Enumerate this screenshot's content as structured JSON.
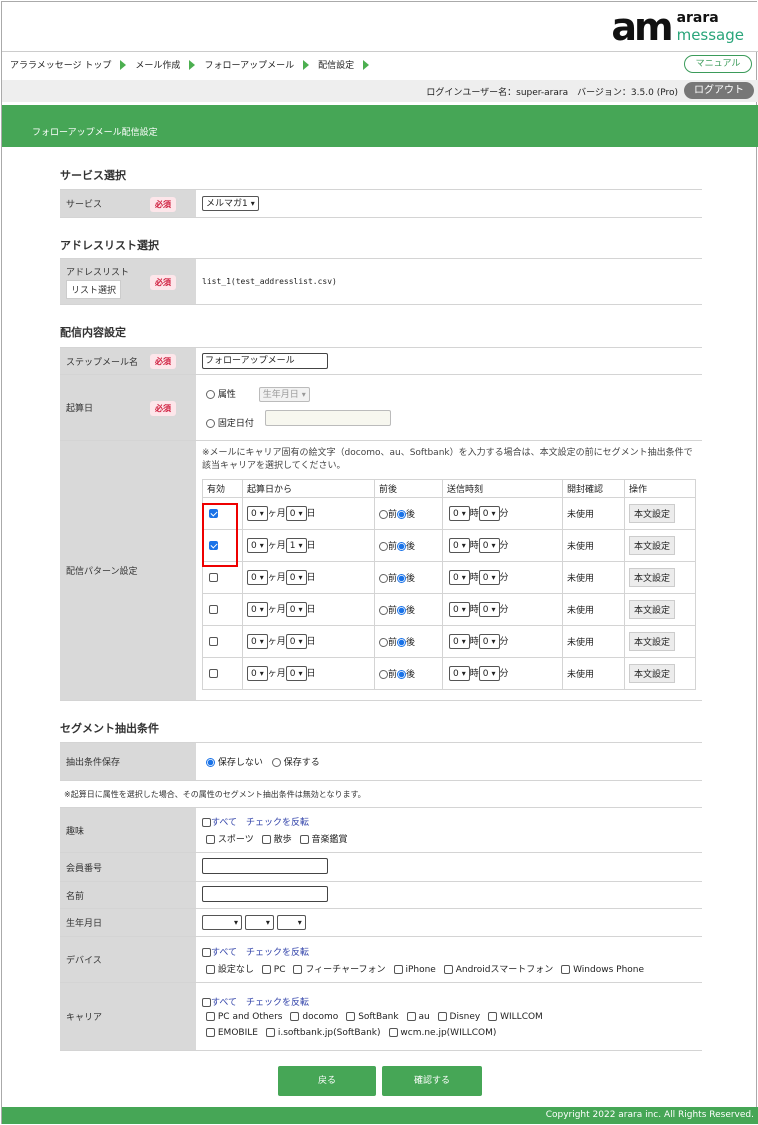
{
  "header": {
    "logo_mark": "am",
    "logo_word1": "arara",
    "logo_word2": "message"
  },
  "breadcrumb": [
    "アララメッセージ トップ",
    "メール作成",
    "フォローアップメール",
    "配信設定"
  ],
  "manual_label": "マニュアル",
  "userbar": {
    "text": "ログインユーザー名：super-arara　バージョン：3.5.0 (Pro)",
    "logout": "ログアウト"
  },
  "page_title": "フォローアップメール配信設定",
  "required_label": "必須",
  "service": {
    "section": "サービス選択",
    "label": "サービス",
    "value": "メルマガ1"
  },
  "address": {
    "section": "アドレスリスト選択",
    "label": "アドレスリスト",
    "button": "リスト選択",
    "value": "list_1(test_addresslist.csv)"
  },
  "delivery": {
    "section": "配信内容設定",
    "step_label": "ステップメール名",
    "step_value": "フォローアップメール",
    "start_label": "起算日",
    "opt_attr": "属性",
    "attr_select": "生年月日",
    "opt_fixed": "固定日付",
    "pattern_label": "配信パターン設定",
    "notice": "※メールにキャリア固有の絵文字（docomo、au、Softbank）を入力する場合は、本文設定の前にセグメント抽出条件で該当キャリアを選択してください。",
    "cols": [
      "有効",
      "起算日から",
      "前後",
      "送信時刻",
      "開封確認",
      "操作"
    ],
    "unit_month": "ヶ月",
    "unit_day": "日",
    "before": "前",
    "after": "後",
    "unit_hour": "時",
    "unit_min": "分",
    "unused": "未使用",
    "body_btn": "本文設定",
    "rows": [
      {
        "checked": true,
        "m": "0",
        "d": "0",
        "h": "0",
        "mi": "0"
      },
      {
        "checked": true,
        "m": "0",
        "d": "1",
        "h": "0",
        "mi": "0"
      },
      {
        "checked": false,
        "m": "0",
        "d": "0",
        "h": "0",
        "mi": "0"
      },
      {
        "checked": false,
        "m": "0",
        "d": "0",
        "h": "0",
        "mi": "0"
      },
      {
        "checked": false,
        "m": "0",
        "d": "0",
        "h": "0",
        "mi": "0"
      },
      {
        "checked": false,
        "m": "0",
        "d": "0",
        "h": "0",
        "mi": "0"
      }
    ]
  },
  "segment": {
    "section": "セグメント抽出条件",
    "save_label": "抽出条件保存",
    "no_save": "保存しない",
    "save": "保存する",
    "note": "※起算日に属性を選択した場合、その属性のセグメント抽出条件は無効となります。",
    "all": "すべて",
    "invert": "チェックを反転",
    "hobby_label": "趣味",
    "hobbies": [
      "スポーツ",
      "散歩",
      "音楽鑑賞"
    ],
    "member_label": "会員番号",
    "name_label": "名前",
    "birth_label": "生年月日",
    "device_label": "デバイス",
    "devices": [
      "設定なし",
      "PC",
      "フィーチャーフォン",
      "iPhone",
      "Androidスマートフォン",
      "Windows Phone"
    ],
    "carrier_label": "キャリア",
    "carriers1": [
      "PC and Others",
      "docomo",
      "SoftBank",
      "au",
      "Disney",
      "WILLCOM"
    ],
    "carriers2": [
      "EMOBILE",
      "i.softbank.jp(SoftBank)",
      "wcm.ne.jp(WILLCOM)"
    ]
  },
  "buttons": {
    "back": "戻る",
    "confirm": "確認する"
  },
  "footer": "Copyright 2022 arara inc. All Rights Reserved.",
  "colors": {
    "green": "#46a656",
    "required": "#d02040",
    "link": "#3344aa"
  }
}
